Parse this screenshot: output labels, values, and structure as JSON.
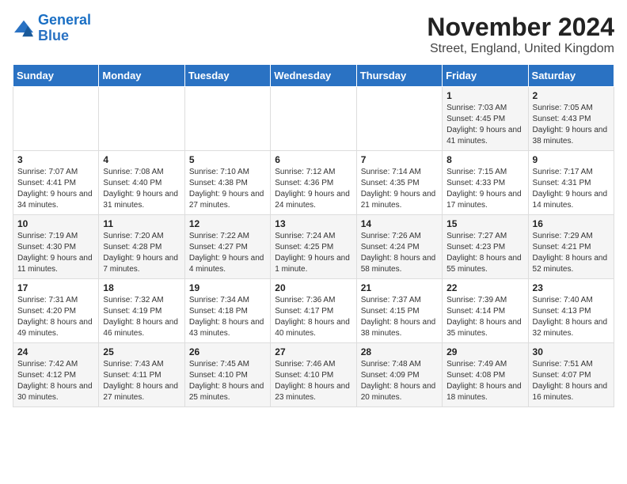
{
  "logo": {
    "line1": "General",
    "line2": "Blue"
  },
  "title": "November 2024",
  "subtitle": "Street, England, United Kingdom",
  "headers": [
    "Sunday",
    "Monday",
    "Tuesday",
    "Wednesday",
    "Thursday",
    "Friday",
    "Saturday"
  ],
  "weeks": [
    [
      {
        "num": "",
        "info": ""
      },
      {
        "num": "",
        "info": ""
      },
      {
        "num": "",
        "info": ""
      },
      {
        "num": "",
        "info": ""
      },
      {
        "num": "",
        "info": ""
      },
      {
        "num": "1",
        "info": "Sunrise: 7:03 AM\nSunset: 4:45 PM\nDaylight: 9 hours and 41 minutes."
      },
      {
        "num": "2",
        "info": "Sunrise: 7:05 AM\nSunset: 4:43 PM\nDaylight: 9 hours and 38 minutes."
      }
    ],
    [
      {
        "num": "3",
        "info": "Sunrise: 7:07 AM\nSunset: 4:41 PM\nDaylight: 9 hours and 34 minutes."
      },
      {
        "num": "4",
        "info": "Sunrise: 7:08 AM\nSunset: 4:40 PM\nDaylight: 9 hours and 31 minutes."
      },
      {
        "num": "5",
        "info": "Sunrise: 7:10 AM\nSunset: 4:38 PM\nDaylight: 9 hours and 27 minutes."
      },
      {
        "num": "6",
        "info": "Sunrise: 7:12 AM\nSunset: 4:36 PM\nDaylight: 9 hours and 24 minutes."
      },
      {
        "num": "7",
        "info": "Sunrise: 7:14 AM\nSunset: 4:35 PM\nDaylight: 9 hours and 21 minutes."
      },
      {
        "num": "8",
        "info": "Sunrise: 7:15 AM\nSunset: 4:33 PM\nDaylight: 9 hours and 17 minutes."
      },
      {
        "num": "9",
        "info": "Sunrise: 7:17 AM\nSunset: 4:31 PM\nDaylight: 9 hours and 14 minutes."
      }
    ],
    [
      {
        "num": "10",
        "info": "Sunrise: 7:19 AM\nSunset: 4:30 PM\nDaylight: 9 hours and 11 minutes."
      },
      {
        "num": "11",
        "info": "Sunrise: 7:20 AM\nSunset: 4:28 PM\nDaylight: 9 hours and 7 minutes."
      },
      {
        "num": "12",
        "info": "Sunrise: 7:22 AM\nSunset: 4:27 PM\nDaylight: 9 hours and 4 minutes."
      },
      {
        "num": "13",
        "info": "Sunrise: 7:24 AM\nSunset: 4:25 PM\nDaylight: 9 hours and 1 minute."
      },
      {
        "num": "14",
        "info": "Sunrise: 7:26 AM\nSunset: 4:24 PM\nDaylight: 8 hours and 58 minutes."
      },
      {
        "num": "15",
        "info": "Sunrise: 7:27 AM\nSunset: 4:23 PM\nDaylight: 8 hours and 55 minutes."
      },
      {
        "num": "16",
        "info": "Sunrise: 7:29 AM\nSunset: 4:21 PM\nDaylight: 8 hours and 52 minutes."
      }
    ],
    [
      {
        "num": "17",
        "info": "Sunrise: 7:31 AM\nSunset: 4:20 PM\nDaylight: 8 hours and 49 minutes."
      },
      {
        "num": "18",
        "info": "Sunrise: 7:32 AM\nSunset: 4:19 PM\nDaylight: 8 hours and 46 minutes."
      },
      {
        "num": "19",
        "info": "Sunrise: 7:34 AM\nSunset: 4:18 PM\nDaylight: 8 hours and 43 minutes."
      },
      {
        "num": "20",
        "info": "Sunrise: 7:36 AM\nSunset: 4:17 PM\nDaylight: 8 hours and 40 minutes."
      },
      {
        "num": "21",
        "info": "Sunrise: 7:37 AM\nSunset: 4:15 PM\nDaylight: 8 hours and 38 minutes."
      },
      {
        "num": "22",
        "info": "Sunrise: 7:39 AM\nSunset: 4:14 PM\nDaylight: 8 hours and 35 minutes."
      },
      {
        "num": "23",
        "info": "Sunrise: 7:40 AM\nSunset: 4:13 PM\nDaylight: 8 hours and 32 minutes."
      }
    ],
    [
      {
        "num": "24",
        "info": "Sunrise: 7:42 AM\nSunset: 4:12 PM\nDaylight: 8 hours and 30 minutes."
      },
      {
        "num": "25",
        "info": "Sunrise: 7:43 AM\nSunset: 4:11 PM\nDaylight: 8 hours and 27 minutes."
      },
      {
        "num": "26",
        "info": "Sunrise: 7:45 AM\nSunset: 4:10 PM\nDaylight: 8 hours and 25 minutes."
      },
      {
        "num": "27",
        "info": "Sunrise: 7:46 AM\nSunset: 4:10 PM\nDaylight: 8 hours and 23 minutes."
      },
      {
        "num": "28",
        "info": "Sunrise: 7:48 AM\nSunset: 4:09 PM\nDaylight: 8 hours and 20 minutes."
      },
      {
        "num": "29",
        "info": "Sunrise: 7:49 AM\nSunset: 4:08 PM\nDaylight: 8 hours and 18 minutes."
      },
      {
        "num": "30",
        "info": "Sunrise: 7:51 AM\nSunset: 4:07 PM\nDaylight: 8 hours and 16 minutes."
      }
    ]
  ]
}
